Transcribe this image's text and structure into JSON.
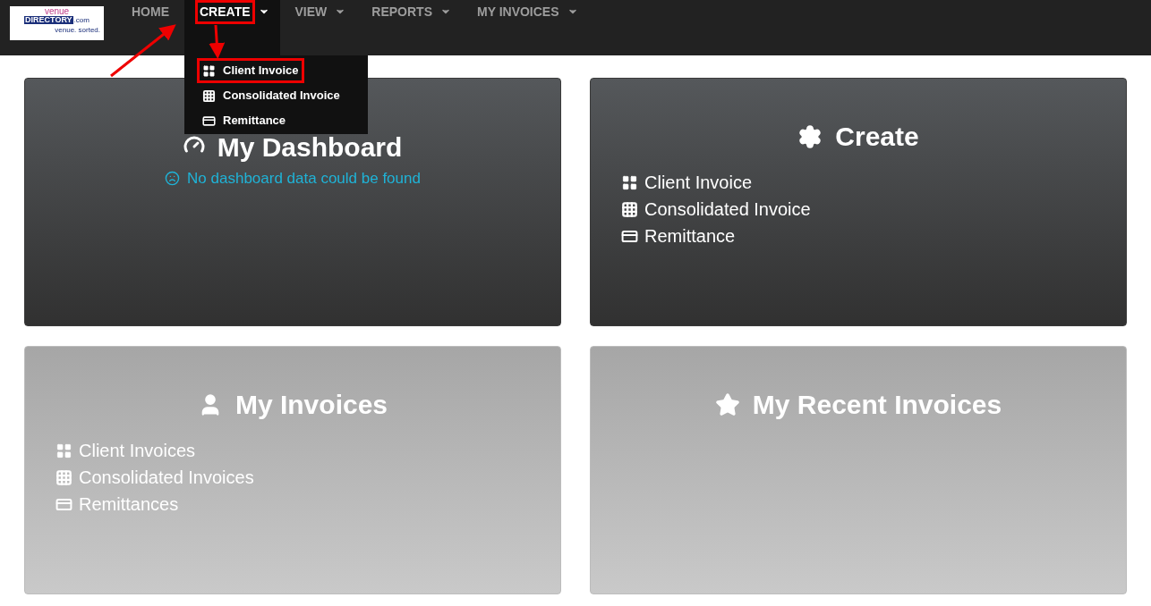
{
  "logo": {
    "word": "venue",
    "brand": "DIRECTORY",
    "domain": ".com",
    "tagline": "venue. sorted."
  },
  "nav": [
    {
      "label": "HOME",
      "dropdown": false,
      "selected": false,
      "highlighted": false
    },
    {
      "label": "CREATE",
      "dropdown": true,
      "selected": true,
      "highlighted": true
    },
    {
      "label": "VIEW",
      "dropdown": true,
      "selected": false,
      "highlighted": false
    },
    {
      "label": "REPORTS",
      "dropdown": true,
      "selected": false,
      "highlighted": false
    },
    {
      "label": "MY INVOICES",
      "dropdown": true,
      "selected": false,
      "highlighted": false
    }
  ],
  "dropdown_menu": [
    {
      "label": "Client Invoice",
      "highlighted": true
    },
    {
      "label": "Consolidated Invoice",
      "highlighted": false
    },
    {
      "label": "Remittance",
      "highlighted": false
    }
  ],
  "cards": [
    {
      "title": "My Dashboard",
      "kind": "dark",
      "message": "No dashboard data could be found"
    },
    {
      "title": "Create",
      "kind": "dark",
      "links": [
        "Client Invoice",
        "Consolidated Invoice",
        "Remittance"
      ]
    },
    {
      "title": "My Invoices",
      "kind": "light",
      "links": [
        "Client Invoices",
        "Consolidated Invoices",
        "Remittances"
      ]
    },
    {
      "title": "My Recent Invoices",
      "kind": "light"
    }
  ]
}
